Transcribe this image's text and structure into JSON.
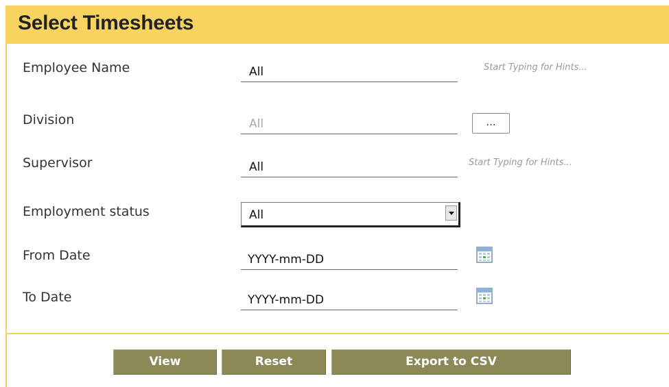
{
  "header": {
    "title": "Select Timesheets"
  },
  "form": {
    "employee_name": {
      "label": "Employee Name",
      "value": "All",
      "hint": "Start Typing for Hints..."
    },
    "division": {
      "label": "Division",
      "value": "All",
      "button_label": "..."
    },
    "supervisor": {
      "label": "Supervisor",
      "value": "All",
      "hint": "Start Typing for Hints..."
    },
    "employment_status": {
      "label": "Employment status",
      "value": "All"
    },
    "from_date": {
      "label": "From Date",
      "value": "YYYY-mm-DD",
      "icon": "calendar-icon"
    },
    "to_date": {
      "label": "To Date",
      "value": "YYYY-mm-DD",
      "icon": "calendar-icon"
    }
  },
  "actions": {
    "view_label": "View",
    "reset_label": "Reset",
    "export_label": "Export to CSV"
  },
  "colors": {
    "header_bg": "#f9d35f",
    "button_bg": "#8b8a56",
    "hint_text": "#9a9a9a"
  }
}
